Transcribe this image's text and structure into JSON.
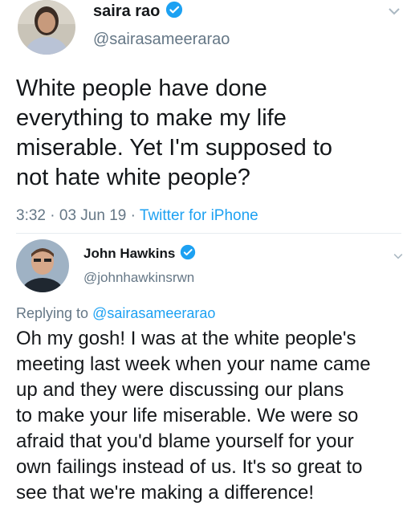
{
  "tweet1": {
    "name": "saira rao",
    "handle": "@sairasameerarao",
    "text_lines": [
      "White people have done",
      "everything to make my life",
      "miserable. Yet I'm supposed to",
      "not hate white people?"
    ],
    "time": "3:32",
    "sep1": "·",
    "date": "03 Jun 19",
    "sep2": "·",
    "source": "Twitter for iPhone",
    "avatar_icon": "user-avatar",
    "verified_icon": "verified-badge-icon"
  },
  "tweet2": {
    "name": "John Hawkins",
    "handle": "@johnhawkinsrwn",
    "replying_prefix": "Replying to",
    "replying_handle": "@sairasameerarao",
    "text_lines": [
      "Oh my gosh! I was at the white people's",
      "meeting last week when your name came",
      "up and they were discussing our plans",
      "to make your life miserable. We were so",
      "afraid that you'd blame yourself for your",
      "own failings instead of us. It's so great to",
      "see that we're making a difference!"
    ],
    "avatar_icon": "user-avatar",
    "verified_icon": "verified-badge-icon"
  },
  "colors": {
    "link": "#1da1f2",
    "secondary_text": "#657786",
    "verified": "#1da1f2"
  }
}
